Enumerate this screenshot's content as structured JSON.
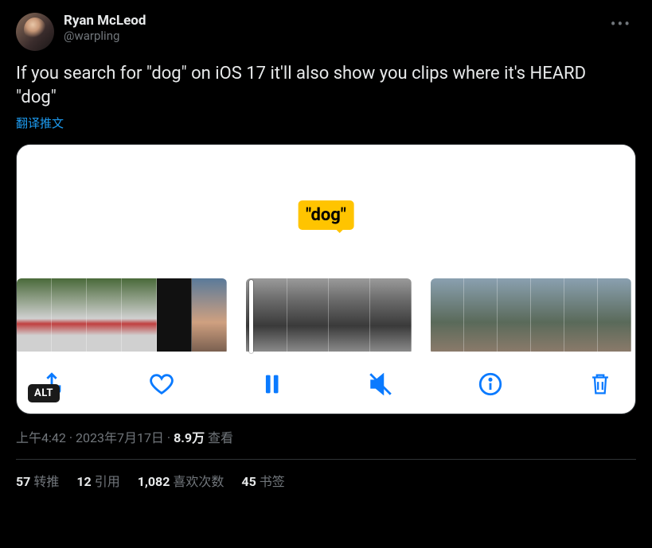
{
  "author": {
    "display_name": "Ryan McLeod",
    "handle": "@warpling"
  },
  "tweet_text": "If you search for \"dog\" on iOS 17 it'll also show you clips where it's HEARD \"dog\"",
  "translate_label": "翻译推文",
  "media": {
    "caption_bubble": "\"dog\"",
    "alt_badge": "ALT",
    "toolbar_icons": {
      "share": "share-icon",
      "like": "heart-icon",
      "pause": "pause-icon",
      "mute": "mute-icon",
      "info": "info-icon",
      "trash": "trash-icon"
    }
  },
  "meta": {
    "time": "上午4:42",
    "date": "2023年7月17日",
    "views_number": "8.9万",
    "views_label": "查看"
  },
  "stats": {
    "retweets": {
      "count": "57",
      "label": "转推"
    },
    "quotes": {
      "count": "12",
      "label": "引用"
    },
    "likes": {
      "count": "1,082",
      "label": "喜欢次数"
    },
    "bookmarks": {
      "count": "45",
      "label": "书签"
    }
  }
}
